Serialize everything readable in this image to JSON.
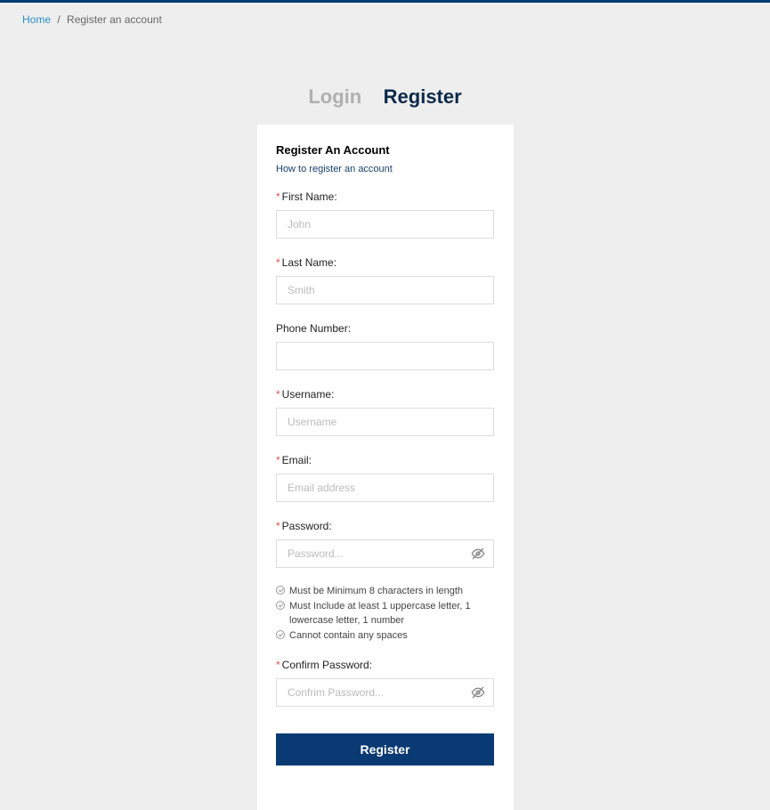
{
  "breadcrumb": {
    "home": "Home",
    "current": "Register an account"
  },
  "tabs": {
    "login": "Login",
    "register": "Register"
  },
  "form": {
    "title": "Register An Account",
    "help": "How to register an account",
    "firstName": {
      "label": "First Name:",
      "placeholder": "John"
    },
    "lastName": {
      "label": "Last Name:",
      "placeholder": "Smith"
    },
    "phone": {
      "label": "Phone Number:",
      "placeholder": ""
    },
    "username": {
      "label": "Username:",
      "placeholder": "Username"
    },
    "email": {
      "label": "Email:",
      "placeholder": "Email address"
    },
    "password": {
      "label": "Password:",
      "placeholder": "Password..."
    },
    "confirmPassword": {
      "label": "Confirm Password:",
      "placeholder": "Confrim Password..."
    },
    "rules": {
      "r1": "Must be Minimum 8 characters in length",
      "r2": "Must Include at least 1 uppercase letter, 1 lowercase letter, 1 number",
      "r3": "Cannot contain any spaces"
    },
    "submit": "Register"
  }
}
